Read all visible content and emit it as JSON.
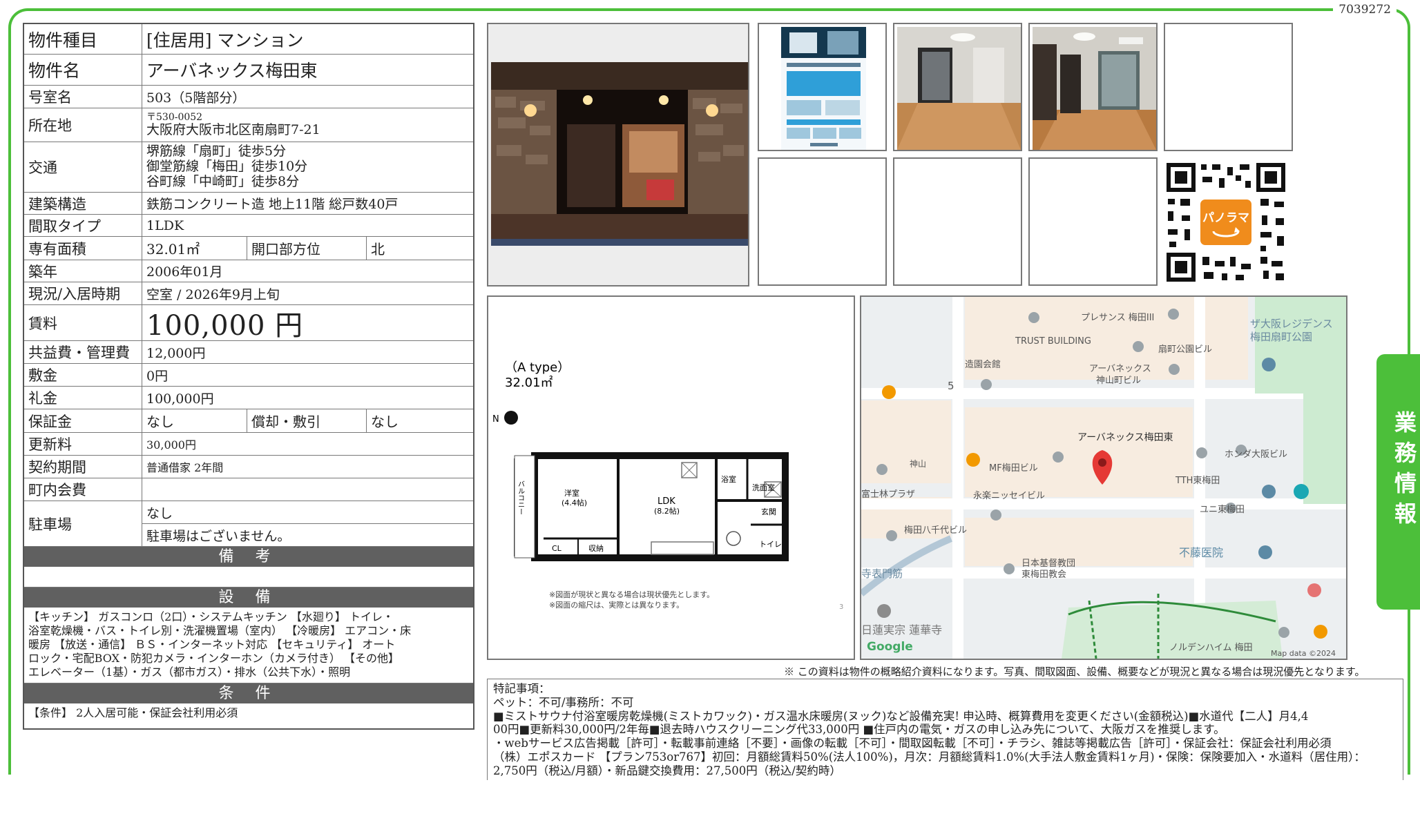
{
  "doc_id": "7039272",
  "spec": {
    "type_label": "物件種目",
    "type_value": "[住居用]  マンション",
    "name_label": "物件名",
    "name_value": "アーバネックス梅田東",
    "room_label": "号室名",
    "room_value": "503（5階部分）",
    "address_label": "所在地",
    "postal": "〒530-0052",
    "address": "大阪府大阪市北区南扇町7-21",
    "traffic_label": "交通",
    "traffic": [
      "堺筋線「扇町」徒歩5分",
      "御堂筋線「梅田」徒歩10分",
      "谷町線「中崎町」徒歩8分"
    ],
    "structure_label": "建築構造",
    "structure_value": "鉄筋コンクリート造  地上11階  総戸数40戸",
    "layout_label": "間取タイプ",
    "layout_value": "1LDK",
    "area_label": "専有面積",
    "area_value": "32.01㎡",
    "opening_label": "開口部方位",
    "opening_value": "北",
    "built_label": "築年",
    "built_value": "2006年01月",
    "status_label": "現況/入居時期",
    "status_value": "空室  /  2026年9月上旬",
    "rent_label": "賃料",
    "rent_value": "100,000 円",
    "fee_label": "共益費・管理費",
    "fee_value": "12,000円",
    "deposit_label": "敷金",
    "deposit_value": "0円",
    "key_label": "礼金",
    "key_value": "100,000円",
    "guarantee_label": "保証金",
    "guarantee_value": "なし",
    "amort_label": "償却・敷引",
    "amort_value": "なし",
    "renewal_label": "更新料",
    "renewal_value": "30,000円",
    "contract_label": "契約期間",
    "contract_value": "普通借家  2年間",
    "assoc_label": "町内会費",
    "assoc_value": "",
    "parking_label": "駐車場",
    "parking_value1": "なし",
    "parking_value2": "駐車場はございません。",
    "remarks_header": "備 考",
    "equipment_header": "設 備",
    "equipment_lines": [
      "【キッチン】 ガスコンロ（2口）・システムキッチン 【水廻り】 トイレ・",
      "浴室乾燥機・バス・トイレ別・洗濯機置場（室内） 【冷暖房】 エアコン・床",
      "暖房 【放送・通信】 ＢＳ・インターネット対応 【セキュリティ】 オート",
      "ロック・宅配BOX・防犯カメラ・インターホン（カメラ付き） 【その他】",
      "エレベーター（1基）・ガス（都市ガス）・排水（公共下水）・照明"
    ],
    "conditions_header": "条 件",
    "conditions_value": "【条件】 2人入居可能・保証会社利用必須"
  },
  "floorplan": {
    "type_label": "（A type）",
    "area_label": "32.01㎡",
    "north": "N",
    "rooms": [
      "洋室",
      "(4.4帖)",
      "LDK",
      "(8.2帖)",
      "浴室",
      "洗面室",
      "玄関",
      "トイレ",
      "CL",
      "収納",
      "バルコニー"
    ],
    "notes": [
      "※図面が現状と異なる場合は現状優先とします。",
      "※図面の縮尺は、実際とは異なります。"
    ],
    "page": "3"
  },
  "qr_badge": "パノラマ",
  "map": {
    "labels": [
      "プレサンス 梅田III",
      "ザ大阪レジデンス",
      "梅田扇町公園",
      "TRUST BUILDING",
      "扇町公園ビル",
      "造園会館",
      "アーバネックス",
      "神山町ビル",
      "5",
      "アーバネックス梅田東",
      "ホンダ大阪ビル",
      "MF梅田ビル",
      "神山",
      "TTH東梅田",
      "富士林プラザ",
      "永楽ニッセイビル",
      "ユニ東梅田",
      "梅田八千代ビル",
      "不藤医院",
      "日本基督教団",
      "東梅田教会",
      "寺表門筋",
      "日蓮実宗 蓮華寺",
      "ノルデンハイム 梅田",
      "Google",
      "Map data ©2024"
    ]
  },
  "side_tab": "業務情報",
  "disclaimer": "※ この資料は物件の概略紹介資料になります。写真、間取図面、設備、概要などが現況と異なる場合は現況優先となります。",
  "notes": [
    "特記事項：",
    "ペット：不可/事務所：不可",
    "■ミストサウナ付浴室暖房乾燥機(ミストカワック)・ガス温水床暖房(ヌック)など設備充実! 申込時、概算費用を変更ください(金額税込)■水道代【二人】月4,4",
    "00円■更新料30,000円/2年毎■退去時ハウスクリーニング代33,000円 ■住戸内の電気・ガスの申し込み先について、大阪ガスを推奨します。",
    "・webサービス広告掲載［許可］・転載事前連絡［不要］・画像の転載［不可］・間取図転載［不可］・チラシ、雑誌等掲載広告［許可］・保証会社：保証会社利用必須",
    "（株）エポスカード 【プラン753or767】初回：月額総賃料50%(法人100%)，月次：月額総賃料1.0%(大手法人敷金賃料1ヶ月)・保険：保険要加入・水道料（居住用）：",
    "2,750円（税込/月額）・新品鍵交換費用：27,500円（税込/契約時）"
  ],
  "colors": {
    "accent_green": "#4cbf3a",
    "header_gray": "#606060",
    "pin_red": "#e53935",
    "panorama_orange": "#f08c1c"
  }
}
